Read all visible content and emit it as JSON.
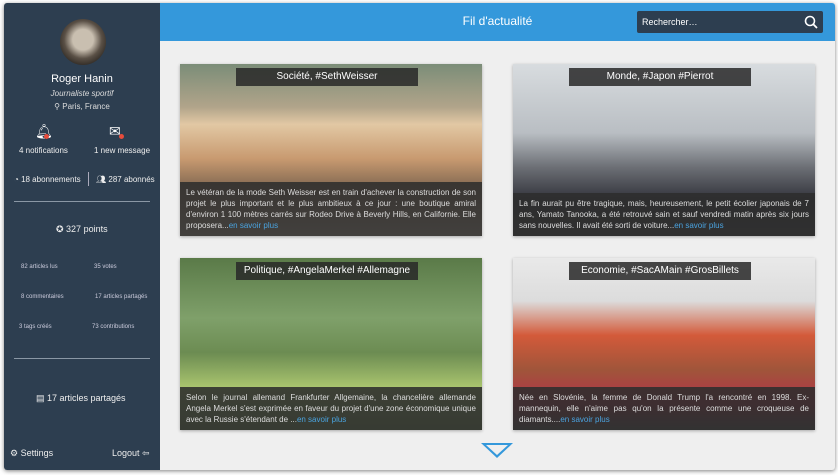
{
  "profile": {
    "name": "Roger Hanin",
    "job": "Journaliste sportif",
    "location": "Paris, France",
    "notifications": "4 notifications",
    "messages": "1 new message",
    "subscriptions": "18 abonnements",
    "followers": "287 abonnés",
    "points": "327 points",
    "stats": [
      "82 articles lus",
      "35 votes",
      "8 commentaires",
      "17 articles partagés",
      "3 tags créés",
      "73 contributions"
    ],
    "shared": "17 articles partagés",
    "settings": "Settings",
    "logout": "Logout"
  },
  "header": {
    "title": "Fil d'actualité",
    "search_placeholder": "Rechercher…"
  },
  "articles": [
    {
      "tag": "Société, #SethWeisser",
      "text": "Le vétéran de la mode Seth Weisser est en train d'achever la construction de son projet le plus important et le plus ambitieux à ce jour : une boutique amiral d'environ 1 100 mètres carrés sur Rodeo Drive à Beverly Hills, en Californie. Elle proposera...",
      "more": "en savoir plus"
    },
    {
      "tag": "Monde, #Japon #Pierrot",
      "text": "La fin aurait pu être tragique, mais, heureusement, le petit écolier japonais de 7 ans, Yamato Tanooka, a été retrouvé sain et sauf vendredi matin après six jours sans nouvelles. Il avait été sorti de voiture...",
      "more": "en savoir plus"
    },
    {
      "tag": "Politique, #AngelaMerkel #Allemagne",
      "text": "Selon le journal allemand Frankfurter Allgemaine, la chancelière allemande Angela Merkel s'est exprimée en faveur du projet d'une zone économique unique avec la Russie s'étendant de ...",
      "more": "en savoir plus"
    },
    {
      "tag": "Economie, #SacAMain #GrosBillets",
      "text": "Née en Slovénie, la femme de Donald Trump l'a rencontré en 1998. Ex-mannequin, elle n'aime pas qu'on la présente comme une croqueuse de diamants....",
      "more": "en savoir plus"
    }
  ]
}
